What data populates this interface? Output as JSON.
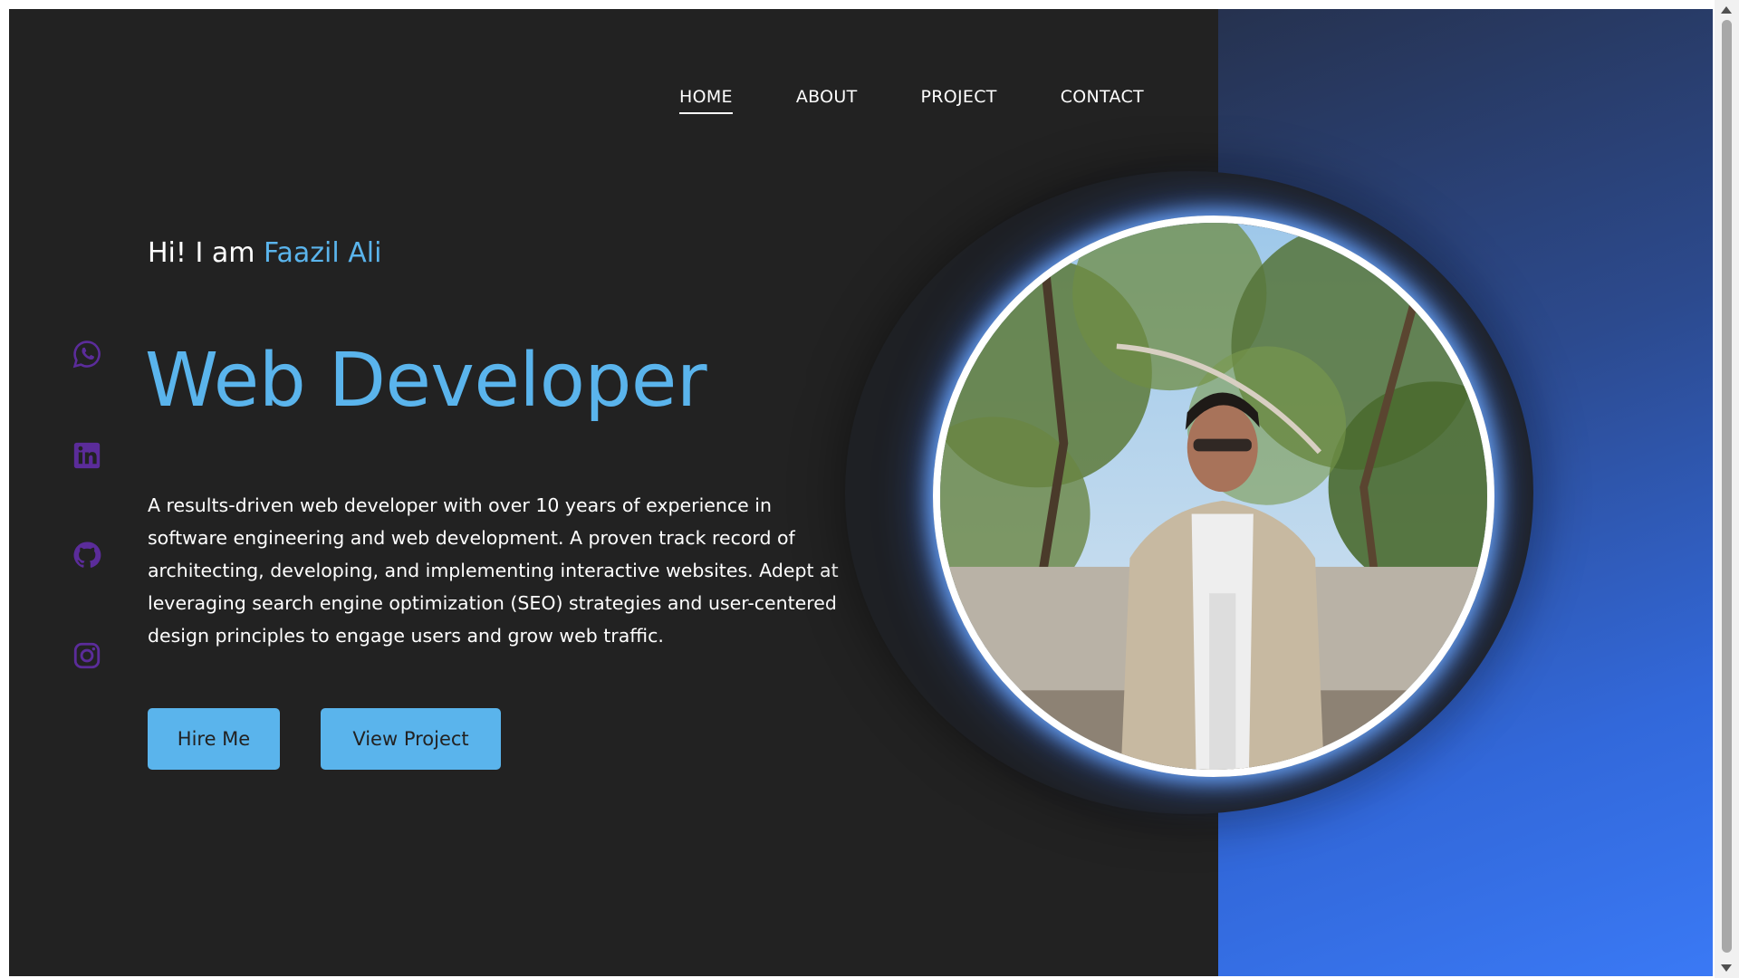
{
  "nav": {
    "items": [
      {
        "label": "HOME",
        "active": true
      },
      {
        "label": "ABOUT",
        "active": false
      },
      {
        "label": "PROJECT",
        "active": false
      },
      {
        "label": "CONTACT",
        "active": false
      }
    ]
  },
  "social": {
    "icons": [
      "whatsapp-icon",
      "linkedin-icon",
      "github-icon",
      "instagram-icon"
    ],
    "color": "#5b2c9a"
  },
  "hero": {
    "greeting_prefix": "Hi! I am ",
    "name": "Faazil Ali",
    "title": "Web Developer",
    "description": "A results-driven web developer with over 10 years of experience in software engineering and web development. A proven track record of architecting, developing, and implementing interactive websites. Adept at leveraging search engine optimization (SEO) strategies and user-centered design principles to engage users and grow web traffic.",
    "buttons": {
      "hire": "Hire Me",
      "view": "View Project"
    }
  },
  "colors": {
    "accent": "#5ab4ec",
    "background": "#222222",
    "panel_gradient_end": "#3a79f5"
  }
}
